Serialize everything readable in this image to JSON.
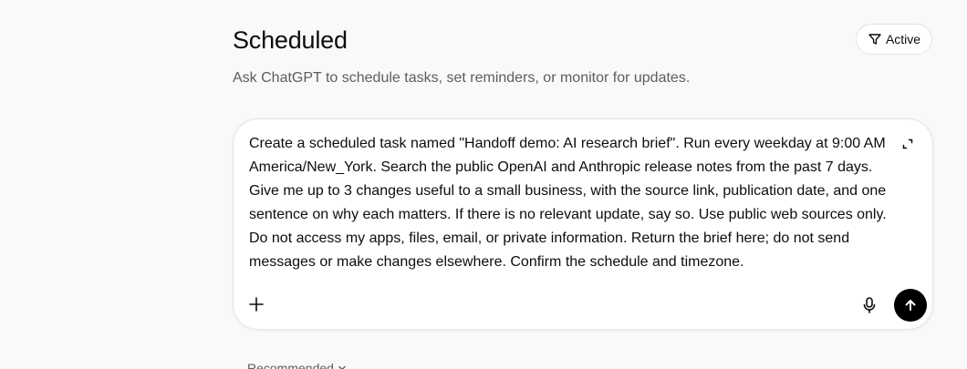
{
  "header": {
    "title": "Scheduled",
    "subtitle": "Ask ChatGPT to schedule tasks, set reminders, or monitor for updates.",
    "filter_label": "Active"
  },
  "composer": {
    "prompt_text": "Create a scheduled task named \"Handoff demo: AI research brief\". Run every weekday at 9:00 AM America/New_York. Search the public OpenAI and Anthropic release notes from the past 7 days. Give me up to 3 changes useful to a small business, with the source link, publication date, and one sentence on why each matters. If there is no relevant update, say so. Use public web sources only. Do not access my apps, files, email, or private information. Return the brief here; do not send messages or make changes elsewhere. Confirm the schedule and timezone.",
    "icons": {
      "expand": "expand-icon",
      "add": "plus-icon",
      "mic": "microphone-icon",
      "send": "arrow-up-icon"
    }
  },
  "recommended": {
    "label": "Recommended"
  },
  "colors": {
    "background": "#f9f9f9",
    "card": "#ffffff",
    "send_button": "#000000",
    "muted_text": "#5d5d5d"
  }
}
